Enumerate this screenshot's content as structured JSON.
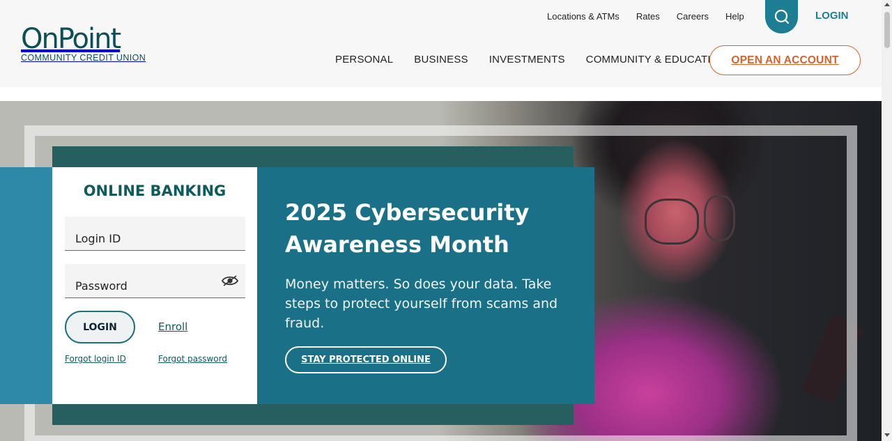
{
  "brand": {
    "name": "OnPoint",
    "subtitle": "COMMUNITY CREDIT UNION",
    "primary_color": "#0e4f57",
    "accent_color": "#d7632a",
    "teal_color": "#1c7d93"
  },
  "utility_nav": {
    "items": [
      {
        "label": "Locations & ATMs"
      },
      {
        "label": "Rates"
      },
      {
        "label": "Careers"
      },
      {
        "label": "Help"
      }
    ],
    "search_icon": "search-icon",
    "login_label": "LOGIN"
  },
  "main_nav": {
    "items": [
      {
        "label": "PERSONAL"
      },
      {
        "label": "BUSINESS"
      },
      {
        "label": "INVESTMENTS"
      },
      {
        "label": "COMMUNITY & EDUCATION"
      }
    ],
    "cta_label": "OPEN AN ACCOUNT"
  },
  "online_banking": {
    "title": "ONLINE BANKING",
    "login_id_placeholder": "Login ID",
    "password_placeholder": "Password",
    "show_password_icon": "eye-icon",
    "login_button": "LOGIN",
    "enroll_link": "Enroll",
    "forgot_login_id": "Forgot login ID",
    "forgot_password": "Forgot password"
  },
  "promo": {
    "title": "2025 Cybersecurity Awareness Month",
    "body": "Money matters. So does your data. Take steps to protect yourself from scams and fraud.",
    "button": "STAY PROTECTED ONLINE"
  }
}
